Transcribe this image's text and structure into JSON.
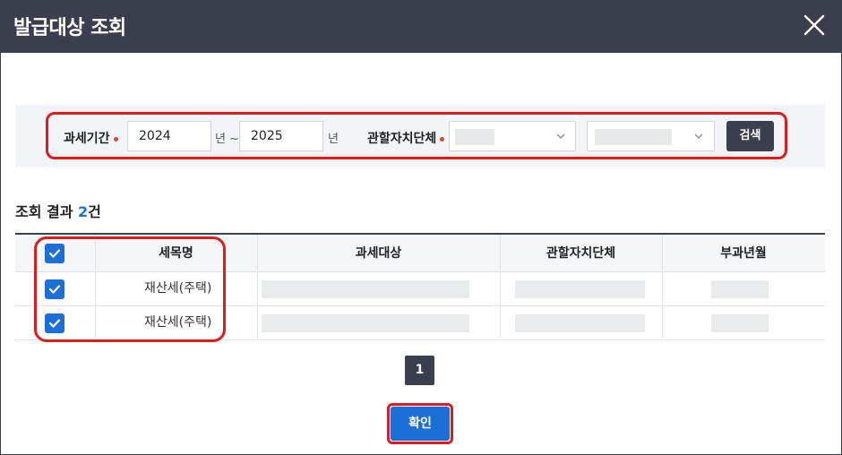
{
  "modal": {
    "title": "발급대상 조회",
    "close_icon": "close-icon"
  },
  "search": {
    "period_label": "과세기간",
    "from_year": "2024",
    "year_unit_from": "년 ~",
    "to_year": "2025",
    "year_unit_to": "년",
    "authority_label": "관할자치단체",
    "select1_value": "",
    "select2_value": "",
    "search_button": "검색",
    "required_color": "#e0442c"
  },
  "result": {
    "prefix": "조회 결과 ",
    "count": "2",
    "suffix": "건"
  },
  "table": {
    "columns": [
      "세목명",
      "과세대상",
      "관할자치단체",
      "부과년월"
    ],
    "rows": [
      {
        "checked": true,
        "tax_name": "재산세(주택)",
        "tax_object": "",
        "authority": "",
        "levy_month": ""
      },
      {
        "checked": true,
        "tax_name": "재산세(주택)",
        "tax_object": "",
        "authority": "",
        "levy_month": ""
      }
    ]
  },
  "pagination": {
    "current": "1"
  },
  "footer": {
    "confirm_button": "확인"
  },
  "colors": {
    "header_bg": "#3b3e4d",
    "accent_blue": "#1d6fd8",
    "highlight_red": "#e01b1b"
  }
}
